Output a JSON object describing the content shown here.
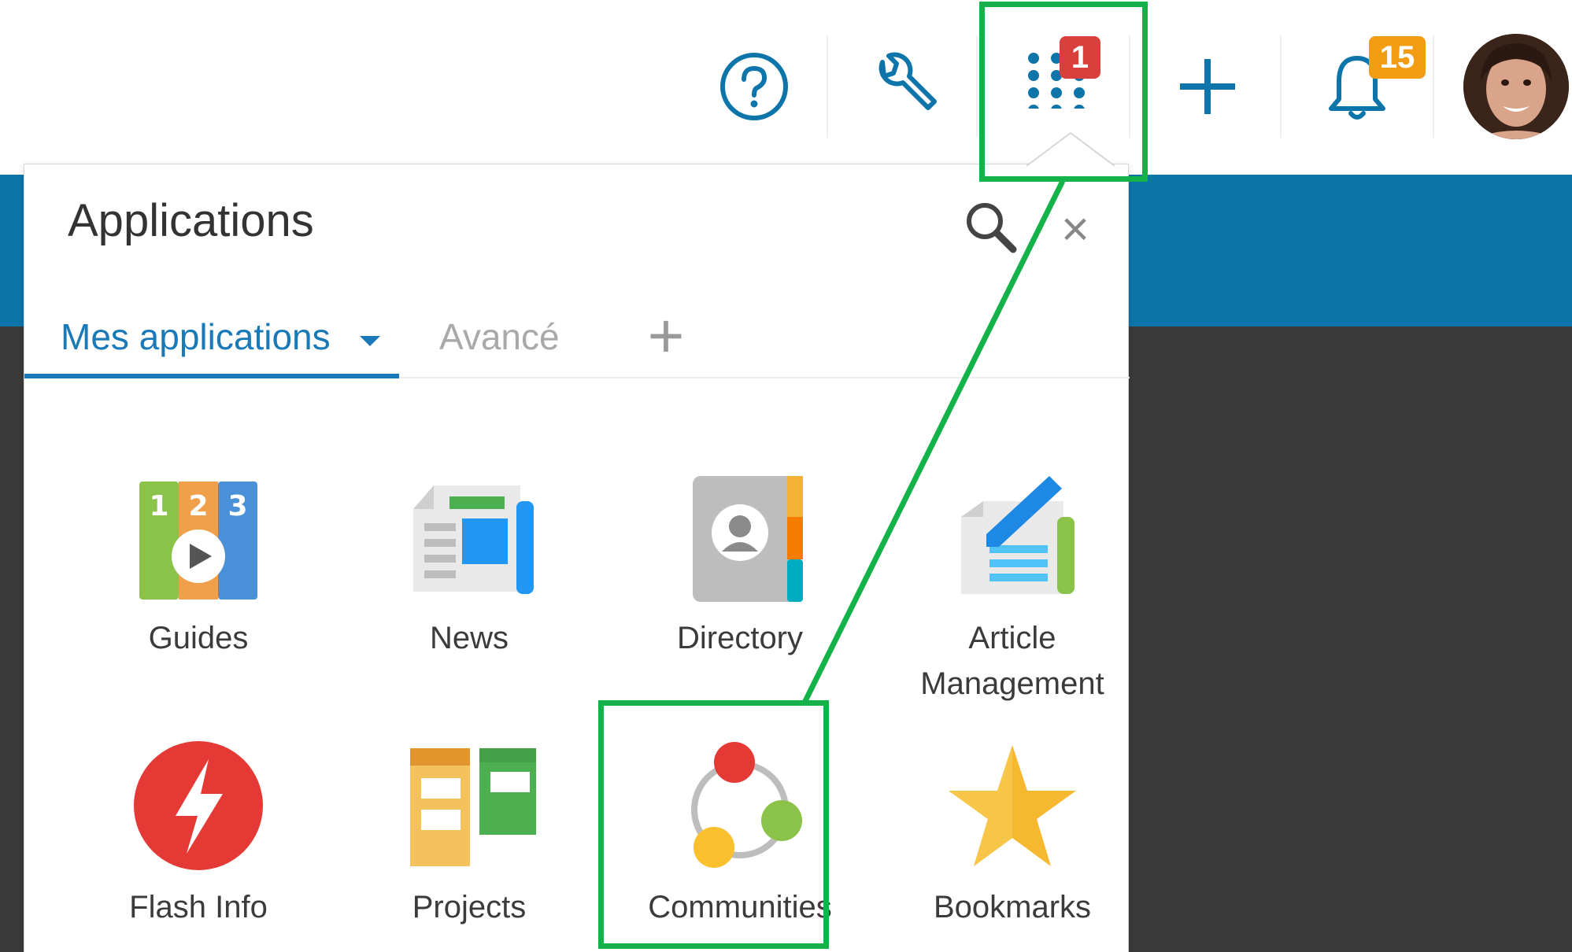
{
  "topbar": {
    "icons": {
      "help": "help-circle-icon",
      "tools": "wrench-icon",
      "apps": "apps-grid-icon",
      "add": "plus-icon",
      "notifications": "bell-icon",
      "avatar": "user-avatar"
    },
    "apps_badge": "1",
    "notifications_badge": "15"
  },
  "panel": {
    "title": "Applications",
    "search_icon": "search-icon",
    "close_label": "×",
    "tabs": [
      {
        "label": "Mes applications",
        "active": true
      },
      {
        "label": "Avancé",
        "active": false
      }
    ],
    "add_tab_label": "+",
    "apps": [
      {
        "label": "Guides",
        "icon": "guides-icon"
      },
      {
        "label": "News",
        "icon": "news-icon"
      },
      {
        "label": "Directory",
        "icon": "directory-icon"
      },
      {
        "label": "Article Management",
        "icon": "article-management-icon"
      },
      {
        "label": "Flash Info",
        "icon": "flash-info-icon"
      },
      {
        "label": "Projects",
        "icon": "projects-icon"
      },
      {
        "label": "Communities",
        "icon": "communities-icon"
      },
      {
        "label": "Bookmarks",
        "icon": "bookmarks-icon"
      }
    ]
  },
  "colors": {
    "accent": "#1a7ab8",
    "header_band": "#0d75a9",
    "highlight": "#14b34a",
    "badge_red": "#d9403c",
    "badge_orange": "#f39c12"
  }
}
